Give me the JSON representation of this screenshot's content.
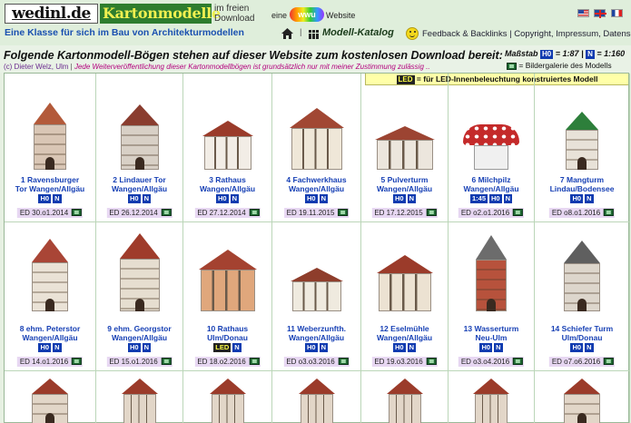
{
  "header": {
    "logo_left": "wedinl.de",
    "logo_right": "Kartonmodelle",
    "free_download": "im freien Download",
    "tagline": "Eine Klasse für sich im Bau von Architekturmodellen",
    "eine": "eine",
    "eine_logo": "wwu",
    "website": "Website",
    "nav_catalog": "Modell-Katalog",
    "nav_links": "Feedback & Backlinks | Copyright, Impressum, Datenschutz",
    "flags": [
      "flag-us-icon",
      "flag-gb-icon",
      "flag-fr-icon"
    ]
  },
  "intro": {
    "headline": "Folgende Kartonmodell-Bögen stehen auf dieser Website zum kostenlosen Download bereit:",
    "author": "(c) Dieter Welz, Ulm",
    "warning": "Jede Weiterveröffentlichung dieser Kartonmodellbögen ist grundsätzlich nur mit meiner Zustimmung zulässig ..",
    "scale_label": "Maßstab",
    "scale_h0": "H0",
    "scale_h0_value": "= 1:87",
    "scale_n": "N",
    "scale_n_value": "= 1:160",
    "gallery_legend": "= Bildergalerie des Modells",
    "led_badge": "LED",
    "led_legend": "= für LED-Innenbeleuchtung konstruiertes Modell"
  },
  "models": [
    {
      "line1": "1 Ravensburger",
      "line2": "Tor Wangen/Allgäu",
      "badges": [
        "H0",
        "N"
      ],
      "ed": "ED 30.o1.2014"
    },
    {
      "line1": "2 Lindauer Tor",
      "line2": "Wangen/Allgäu",
      "badges": [
        "H0",
        "N"
      ],
      "ed": "ED 26.12.2014"
    },
    {
      "line1": "3 Rathaus",
      "line2": "Wangen/Allgäu",
      "badges": [
        "H0",
        "N"
      ],
      "ed": "ED 27.12.2014"
    },
    {
      "line1": "4 Fachwerkhaus",
      "line2": "Wangen/Allgäu",
      "badges": [
        "H0",
        "N"
      ],
      "ed": "ED 19.11.2015"
    },
    {
      "line1": "5 Pulverturm",
      "line2": "Wangen/Allgäu",
      "badges": [
        "H0",
        "N"
      ],
      "ed": "ED 17.12.2015"
    },
    {
      "line1": "6 Milchpilz",
      "line2": "Wangen/Allgäu",
      "badges": [
        "1:45",
        "H0",
        "N"
      ],
      "ed": "ED o2.o1.2016"
    },
    {
      "line1": "7 Mangturm",
      "line2": "Lindau/Bodensee",
      "badges": [
        "H0",
        "N"
      ],
      "ed": "ED o8.o1.2016"
    },
    {
      "line1": "8 ehm. Peterstor",
      "line2": "Wangen/Allgäu",
      "badges": [
        "H0",
        "N"
      ],
      "ed": "ED 14.o1.2016"
    },
    {
      "line1": "9 ehm. Georgstor",
      "line2": "Wangen/Allgäu",
      "badges": [
        "H0",
        "N"
      ],
      "ed": "ED 15.o1.2016"
    },
    {
      "line1": "10 Rathaus",
      "line2": "Ulm/Donau",
      "badges": [
        "LED",
        "N"
      ],
      "ed": "ED 18.o2.2016"
    },
    {
      "line1": "11 Weberzunfth.",
      "line2": "Wangen/Allgäu",
      "badges": [
        "H0",
        "N"
      ],
      "ed": "ED o3.o3.2016"
    },
    {
      "line1": "12 Eselmühle",
      "line2": "Wangen/Allgäu",
      "badges": [
        "H0",
        "N"
      ],
      "ed": "ED 19.o3.2016"
    },
    {
      "line1": "13 Wasserturm",
      "line2": "Neu-Ulm",
      "badges": [
        "H0",
        "N"
      ],
      "ed": "ED o3.o4.2016"
    },
    {
      "line1": "14 Schiefer Turm",
      "line2": "Ulm/Donau",
      "badges": [
        "H0",
        "N"
      ],
      "ed": "ED o7.o6.2016"
    }
  ],
  "colors": {
    "title_blue": "#1841b5",
    "badge_blue": "#103bb0",
    "ed_background": "#e7d7f2",
    "banner_yellow": "#ffffa8"
  }
}
